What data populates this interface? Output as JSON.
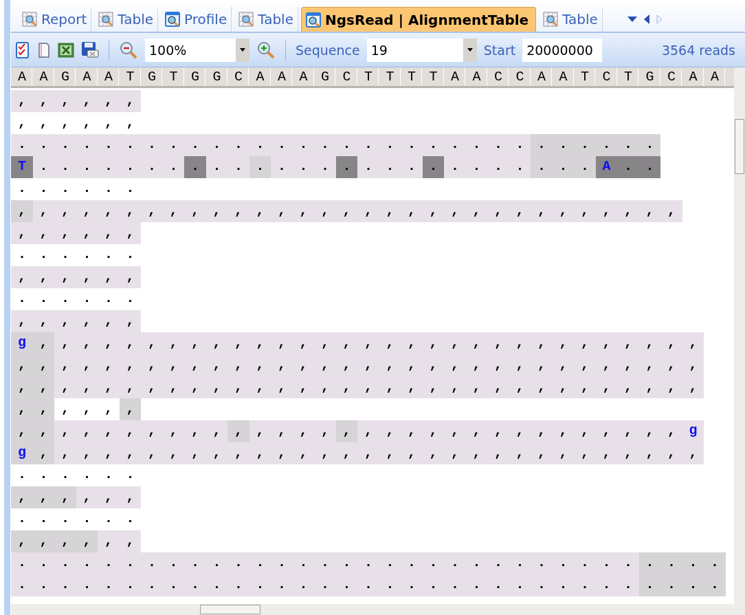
{
  "tabs": [
    {
      "label": "Report",
      "selected": false
    },
    {
      "label": "Table",
      "selected": false
    },
    {
      "label": "Profile",
      "selected": false
    },
    {
      "label": "Table",
      "selected": false
    },
    {
      "label": "NgsRead | AlignmentTable",
      "selected": true
    },
    {
      "label": "Table",
      "selected": false
    }
  ],
  "toolbar": {
    "zoom": "100%",
    "sequence_label": "Sequence",
    "sequence": "19",
    "start_label": "Start",
    "start": "20000000",
    "reads_count": "3564 reads"
  },
  "reference": "AAGAATGTGGCAAAGCTTTTAACCAATCTGCAA",
  "reads": [
    {
      "shaded": true,
      "segments": [
        {
          "bases": ",,,,,,",
          "kind": "plain",
          "mismatch": false
        }
      ]
    },
    {
      "shaded": false,
      "segments": [
        {
          "bases": ",,,,,,",
          "kind": "plain",
          "mismatch": false
        }
      ]
    },
    {
      "shaded": true,
      "segments": [
        {
          "bases": "........................",
          "kind": "plain",
          "mismatch": false
        },
        {
          "bases": "......",
          "kind": "light",
          "mismatch": false
        }
      ]
    },
    {
      "shaded": true,
      "segments": [
        {
          "bases": "T",
          "kind": "dark",
          "mismatch": true
        },
        {
          "bases": ".......",
          "kind": "plain",
          "mismatch": false
        },
        {
          "bases": ".",
          "kind": "dark",
          "mismatch": false
        },
        {
          "bases": "..",
          "kind": "plain",
          "mismatch": false
        },
        {
          "bases": ".",
          "kind": "light",
          "mismatch": false
        },
        {
          "bases": "...",
          "kind": "plain",
          "mismatch": false
        },
        {
          "bases": ".",
          "kind": "dark",
          "mismatch": false
        },
        {
          "bases": "...",
          "kind": "plain",
          "mismatch": false
        },
        {
          "bases": ".",
          "kind": "dark",
          "mismatch": false
        },
        {
          "bases": "....",
          "kind": "plain",
          "mismatch": false
        },
        {
          "bases": "...",
          "kind": "light",
          "mismatch": false
        },
        {
          "bases": "A",
          "kind": "dark",
          "mismatch": true
        },
        {
          "bases": "..",
          "kind": "dark",
          "mismatch": false
        }
      ]
    },
    {
      "shaded": false,
      "segments": [
        {
          "bases": "......",
          "kind": "plain",
          "mismatch": false
        }
      ]
    },
    {
      "shaded": true,
      "segments": [
        {
          "bases": ",",
          "kind": "light",
          "mismatch": false
        },
        {
          "bases": ",,,,,,,,,,,,,,,,,,,,,,,,,,,,,,",
          "kind": "plain",
          "mismatch": false
        }
      ]
    },
    {
      "shaded": true,
      "segments": [
        {
          "bases": ",,,,,,",
          "kind": "plain",
          "mismatch": false
        }
      ]
    },
    {
      "shaded": false,
      "segments": [
        {
          "bases": "......",
          "kind": "plain",
          "mismatch": false
        }
      ]
    },
    {
      "shaded": true,
      "segments": [
        {
          "bases": ",,,,,,",
          "kind": "plain",
          "mismatch": false
        }
      ]
    },
    {
      "shaded": false,
      "segments": [
        {
          "bases": "......",
          "kind": "plain",
          "mismatch": false
        }
      ]
    },
    {
      "shaded": true,
      "segments": [
        {
          "bases": ",,,,,,",
          "kind": "plain",
          "mismatch": false
        }
      ]
    },
    {
      "shaded": true,
      "segments": [
        {
          "bases": "g",
          "kind": "light",
          "mismatch": true
        },
        {
          "bases": ",",
          "kind": "light",
          "mismatch": false
        },
        {
          "bases": ",,,,,,,,,,,,,,,,,,,,,,,,,,,,,,",
          "kind": "plain",
          "mismatch": false
        }
      ]
    },
    {
      "shaded": true,
      "segments": [
        {
          "bases": ",,",
          "kind": "light",
          "mismatch": false
        },
        {
          "bases": ",,,,,,,,,,,,,,,,,,,,,,,,,,,,,,",
          "kind": "plain",
          "mismatch": false
        }
      ]
    },
    {
      "shaded": true,
      "segments": [
        {
          "bases": ",,",
          "kind": "light",
          "mismatch": false
        },
        {
          "bases": ",,,,,,,,,,,,,,,,,,,,,,,,,,,,,,",
          "kind": "plain",
          "mismatch": false
        }
      ]
    },
    {
      "shaded": false,
      "segments": [
        {
          "bases": ",,",
          "kind": "light",
          "mismatch": false
        },
        {
          "bases": ",,,",
          "kind": "plain",
          "mismatch": false
        },
        {
          "bases": ",",
          "kind": "light",
          "mismatch": false
        }
      ]
    },
    {
      "shaded": true,
      "segments": [
        {
          "bases": ",,",
          "kind": "light",
          "mismatch": false
        },
        {
          "bases": ",,,,,,,,",
          "kind": "plain",
          "mismatch": false
        },
        {
          "bases": ",",
          "kind": "light",
          "mismatch": false
        },
        {
          "bases": ",,,,",
          "kind": "plain",
          "mismatch": false
        },
        {
          "bases": ",",
          "kind": "light",
          "mismatch": false
        },
        {
          "bases": ",,,,,,,,,,,,,,,",
          "kind": "plain",
          "mismatch": false
        },
        {
          "bases": "g",
          "kind": "plain",
          "mismatch": true
        }
      ]
    },
    {
      "shaded": true,
      "segments": [
        {
          "bases": "g",
          "kind": "light",
          "mismatch": true
        },
        {
          "bases": ",",
          "kind": "light",
          "mismatch": false
        },
        {
          "bases": ",,,,,,,,,,,,,,,,,,,,,,,,,,,,,,",
          "kind": "plain",
          "mismatch": false
        }
      ]
    },
    {
      "shaded": false,
      "segments": [
        {
          "bases": "......",
          "kind": "plain",
          "mismatch": false
        }
      ]
    },
    {
      "shaded": true,
      "segments": [
        {
          "bases": ",,,",
          "kind": "light",
          "mismatch": false
        },
        {
          "bases": ",,,",
          "kind": "plain",
          "mismatch": false
        }
      ]
    },
    {
      "shaded": false,
      "segments": [
        {
          "bases": "......",
          "kind": "plain",
          "mismatch": false
        }
      ]
    },
    {
      "shaded": true,
      "segments": [
        {
          "bases": ",,,,",
          "kind": "light",
          "mismatch": false
        },
        {
          "bases": ",,",
          "kind": "plain",
          "mismatch": false
        }
      ]
    },
    {
      "shaded": true,
      "segments": [
        {
          "bases": ".............................",
          "kind": "plain",
          "mismatch": false
        },
        {
          "bases": "....",
          "kind": "light",
          "mismatch": false
        }
      ]
    },
    {
      "shaded": true,
      "segments": [
        {
          "bases": ".............................",
          "kind": "plain",
          "mismatch": false
        },
        {
          "bases": "....",
          "kind": "light",
          "mismatch": false
        }
      ]
    }
  ]
}
